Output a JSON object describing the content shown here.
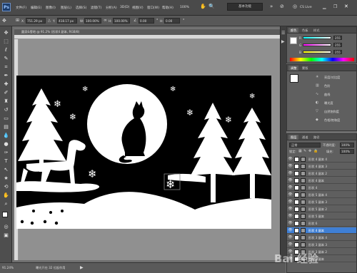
{
  "menubar": {
    "logo": "Ps",
    "items": [
      "文件(F)",
      "编辑(E)",
      "图像(I)",
      "图层(L)",
      "选择(S)",
      "滤镜(T)",
      "分析(A)",
      "3D(D)",
      "视图(V)",
      "窗口(W)",
      "帮助(H)"
    ],
    "zoom": "100%",
    "workspace": "基本功能",
    "cslive": "CS Live"
  },
  "options": {
    "x_label": "X:",
    "x_value": "751.29 px",
    "y_label": "Y:",
    "y_value": "418.17 px",
    "w_label": "W:",
    "w_value": "100.00%",
    "h_label": "H:",
    "h_value": "100.00%",
    "angle_value": "0.00",
    "h_skew_label": "H:",
    "h_skew_value": "0.00"
  },
  "document": {
    "tab_title": "圆家&雪地 @ 91.2% (形状4 副本, RGB/8)",
    "status_zoom": "91.24%",
    "status_text": "曝光只在 32 位起作用"
  },
  "color_panel": {
    "tabs": [
      "颜色",
      "色板",
      "样式"
    ],
    "r_label": "R",
    "r_value": "255",
    "g_label": "G",
    "g_value": "255",
    "b_label": "B",
    "b_value": "255",
    "fg_color": "#ffffff",
    "bg_color": "#000000"
  },
  "adjust_panel": {
    "tabs": [
      "调整",
      "蒙版"
    ],
    "items": [
      "亮度/对比度",
      "色阶",
      "曲线",
      "曝光度",
      "自然饱和度",
      "色相/饱和度"
    ]
  },
  "layers_panel": {
    "tabs": [
      "图层",
      "通道",
      "路径"
    ],
    "blend_mode": "正常",
    "opacity_label": "不透明度:",
    "opacity_value": "100%",
    "lock_label": "锁定:",
    "fill_label": "填充:",
    "fill_value": "100%",
    "layers": [
      {
        "name": "形状 4 副本 4",
        "selected": false
      },
      {
        "name": "形状 4 副本 3",
        "selected": false
      },
      {
        "name": "形状 4 副本 2",
        "selected": false
      },
      {
        "name": "形状 4 副本",
        "selected": false
      },
      {
        "name": "形状 4",
        "selected": false
      },
      {
        "name": "形状 5 副本 4",
        "selected": false
      },
      {
        "name": "形状 5 副本 3",
        "selected": false
      },
      {
        "name": "形状 5 副本 2",
        "selected": false
      },
      {
        "name": "形状 5 副本",
        "selected": false
      },
      {
        "name": "形状 6",
        "selected": false
      },
      {
        "name": "形状 4 副本",
        "selected": true
      },
      {
        "name": "形状 3 副本 4",
        "selected": false
      },
      {
        "name": "形状 3 副本 3",
        "selected": false
      },
      {
        "name": "形状 3 副本 2",
        "selected": false
      },
      {
        "name": "形状 3 副本",
        "selected": false
      }
    ]
  },
  "watermark": "Bai 经验"
}
